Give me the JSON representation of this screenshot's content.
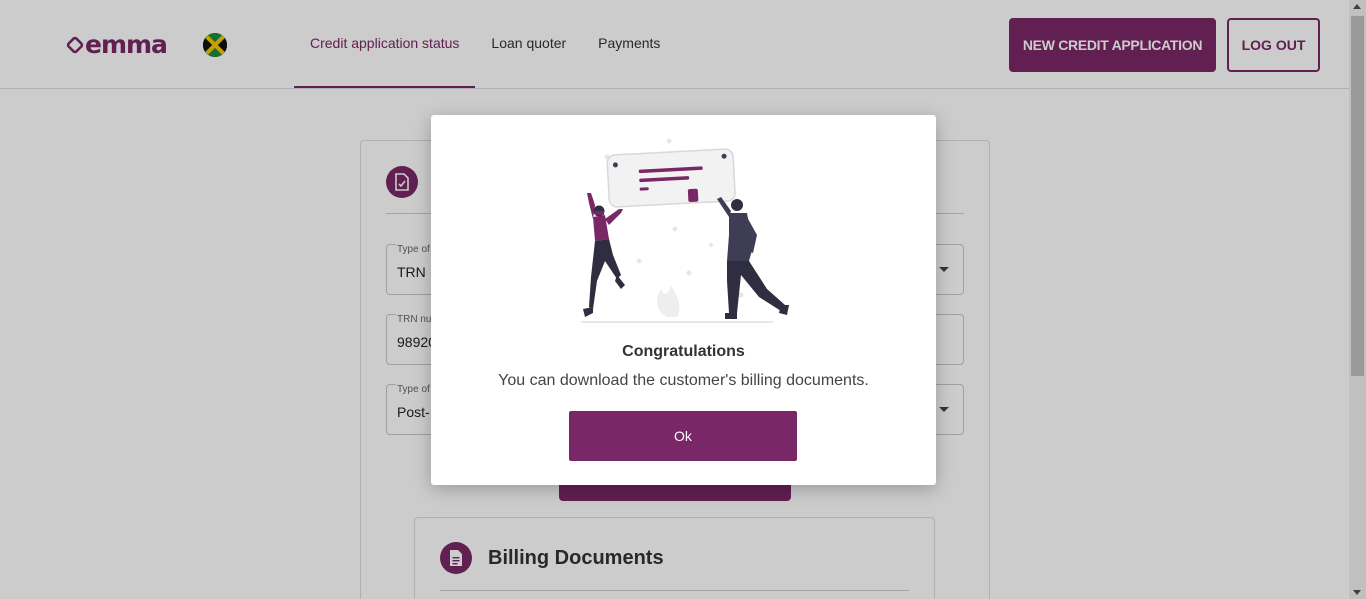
{
  "brand": {
    "logo_text": "emma",
    "country_flag": "jamaica-flag-icon",
    "accent": "#7a2767"
  },
  "nav": {
    "tabs": [
      {
        "label": "Credit application status",
        "active": true
      },
      {
        "label": "Loan quoter",
        "active": false
      },
      {
        "label": "Payments",
        "active": false
      }
    ]
  },
  "header_actions": {
    "new_application_label": "NEW CREDIT APPLICATION",
    "logout_label": "LOG OUT"
  },
  "form": {
    "icon": "document-check-icon",
    "fields": [
      {
        "label": "Type of",
        "value": "TRN",
        "dropdown": true
      },
      {
        "label": "TRN nu",
        "value": "98920",
        "dropdown": false
      },
      {
        "label": "Type of",
        "value": "Post-",
        "dropdown": true
      }
    ]
  },
  "billing": {
    "icon": "document-icon",
    "title": "Billing Documents"
  },
  "modal": {
    "illustration": "celebration-illustration",
    "title": "Congratulations",
    "message": "You can download the customer's billing documents.",
    "ok_label": "Ok"
  }
}
